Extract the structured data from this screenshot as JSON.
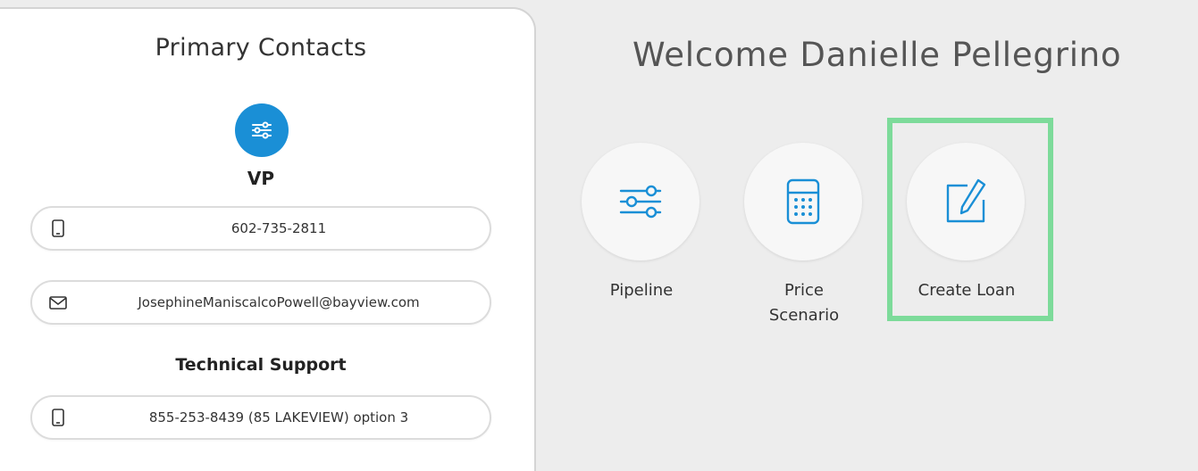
{
  "contacts": {
    "title": "Primary Contacts",
    "vp": {
      "title": "VP",
      "phone": "602-735-2811",
      "email": "JosephineManiscalcoPowell@bayview.com"
    },
    "support": {
      "title": "Technical Support",
      "phone": "855-253-8439 (85 LAKEVIEW) option 3"
    }
  },
  "main": {
    "welcome": "Welcome Danielle Pellegrino",
    "tiles": [
      {
        "label": "Pipeline",
        "icon": "sliders-icon"
      },
      {
        "label_line1": "Price",
        "label_line2": "Scenario",
        "icon": "calculator-icon"
      },
      {
        "label": "Create Loan",
        "icon": "edit-icon"
      }
    ]
  },
  "colors": {
    "accent": "#1a8fd6",
    "highlight": "#7ddb9a",
    "background": "#ededed"
  }
}
